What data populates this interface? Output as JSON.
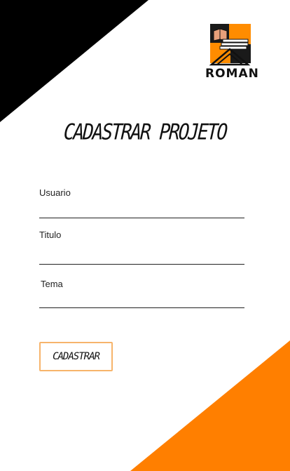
{
  "logo": {
    "text": "ROMAN",
    "icon": "book-stack-icon",
    "accent_color": "#ff8c00"
  },
  "page": {
    "title": "CADASTRAR PROJETO"
  },
  "form": {
    "fields": [
      {
        "label": "Usuario",
        "value": "",
        "placeholder": ""
      },
      {
        "label": "Titulo",
        "value": "",
        "placeholder": ""
      },
      {
        "label": "Tema",
        "value": "",
        "placeholder": ""
      }
    ],
    "submit_label": "CADASTRAR"
  },
  "colors": {
    "corner_top": "#000000",
    "corner_bottom": "#ff7f00",
    "button_border": "#f7b46b"
  }
}
